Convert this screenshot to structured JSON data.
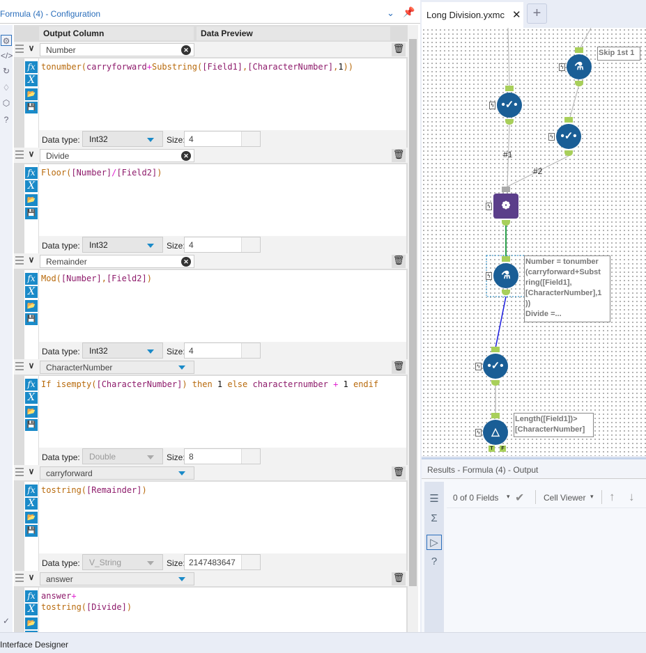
{
  "config": {
    "title": "Formula (4) - Configuration",
    "columns": {
      "output": "Output Column",
      "preview": "Data Preview"
    },
    "labels": {
      "data_type": "Data type:",
      "size": "Size:"
    },
    "formulas": [
      {
        "name": "Number",
        "new_field": true,
        "data_type": "Int32",
        "type_enabled": true,
        "size": "4",
        "tokens": [
          [
            "fn",
            "tonumber("
          ],
          [
            "id",
            "carryforward"
          ],
          [
            "op",
            "+"
          ],
          [
            "fn",
            "Substring("
          ],
          [
            "fld",
            "[Field1]"
          ],
          [
            "p",
            ","
          ],
          [
            "fld",
            "[CharacterNumber]"
          ],
          [
            "p",
            ","
          ],
          [
            "num",
            "1"
          ],
          [
            "p",
            "))"
          ]
        ]
      },
      {
        "name": "Divide",
        "new_field": true,
        "data_type": "Int32",
        "type_enabled": true,
        "size": "4",
        "tokens": [
          [
            "fn",
            "Floor("
          ],
          [
            "fld",
            "[Number]"
          ],
          [
            "op",
            "/"
          ],
          [
            "fld",
            "[Field2]"
          ],
          [
            "p",
            ")"
          ]
        ]
      },
      {
        "name": "Remainder",
        "new_field": true,
        "data_type": "Int32",
        "type_enabled": true,
        "size": "4",
        "tokens": [
          [
            "fn",
            "Mod("
          ],
          [
            "fld",
            "[Number]"
          ],
          [
            "p",
            ","
          ],
          [
            "fld",
            "[Field2]"
          ],
          [
            "p",
            ")"
          ]
        ]
      },
      {
        "name": "CharacterNumber",
        "new_field": false,
        "data_type": "Double",
        "type_enabled": false,
        "size": "8",
        "tokens": [
          [
            "kw",
            "If "
          ],
          [
            "fn",
            "isempty("
          ],
          [
            "fld",
            "[CharacterNumber]"
          ],
          [
            "p",
            ") "
          ],
          [
            "kw",
            "then "
          ],
          [
            "num",
            "1 "
          ],
          [
            "kw",
            "else "
          ],
          [
            "id",
            "characternumber "
          ],
          [
            "op",
            "+ "
          ],
          [
            "num",
            "1 "
          ],
          [
            "kw",
            "endif"
          ]
        ]
      },
      {
        "name": "carryforward",
        "new_field": false,
        "data_type": "V_String",
        "type_enabled": false,
        "size": "2147483647",
        "tokens": [
          [
            "fn",
            "tostring("
          ],
          [
            "fld",
            "[Remainder]"
          ],
          [
            "p",
            ")"
          ]
        ]
      },
      {
        "name": "answer",
        "new_field": false,
        "data_type": "",
        "type_enabled": false,
        "size": "",
        "tokens": [
          [
            "id",
            "answer"
          ],
          [
            "op",
            "+\n"
          ],
          [
            "fn",
            "tostring("
          ],
          [
            "fld",
            "[Divide]"
          ],
          [
            "p",
            ")"
          ]
        ]
      }
    ]
  },
  "workflow": {
    "tab": "Long Division.yxmc",
    "annotations": {
      "sample": "Skip 1st 1",
      "join_in1": "#1",
      "join_in2": "#2",
      "formula": "Number = tonumber\n(carryforward+Subst\nring([Field1],\n[CharacterNumber],1\n))\nDivide =...",
      "filter": "Length([Field1])>\n[CharacterNumber]",
      "filter_true": "T",
      "filter_false": "F"
    },
    "colors": {
      "tool_blue": "#1a5e96",
      "join_purple": "#5b3e8a",
      "anchor_green": "#a8cf5a"
    }
  },
  "results": {
    "title": "Results - Formula (4) - Output",
    "fields": "0 of 0 Fields",
    "viewer": "Cell Viewer"
  },
  "status": {
    "label": "Interface Designer"
  }
}
